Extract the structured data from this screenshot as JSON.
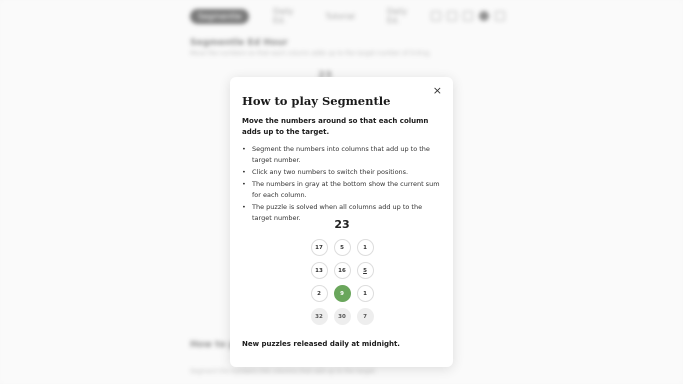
{
  "background": {
    "nav_tabs": [
      "Segmentle",
      "Daily Ed.",
      "Tutorial",
      "Daily Ed."
    ],
    "title": "Segmentle Ed Hour",
    "subtitle": "Move the numbers so that each column adds up to the target number of it-king.",
    "preview": "23",
    "howto_title": "How to play",
    "howto_sub": "Segment the numbers into columns that add up to the target."
  },
  "modal": {
    "title": "How to play Segmentle",
    "close_label": "×",
    "intro": "Move the numbers around so that each column adds up to the target.",
    "rules": [
      "Segment the numbers into columns that add up to the target number.",
      "Click any two numbers to switch their positions.",
      "The numbers in gray at the bottom show the current sum for each column.",
      "The puzzle is solved when all columns add up to the target number."
    ],
    "example": {
      "target": "23",
      "rows": [
        [
          "17",
          "5",
          "1"
        ],
        [
          "13",
          "16",
          "5"
        ],
        [
          "2",
          "9",
          "1"
        ]
      ],
      "sums": [
        "32",
        "30",
        "7"
      ],
      "selected_cell": "9",
      "selected_color": "#6aa65c"
    },
    "footer": "New puzzles released daily at midnight."
  }
}
